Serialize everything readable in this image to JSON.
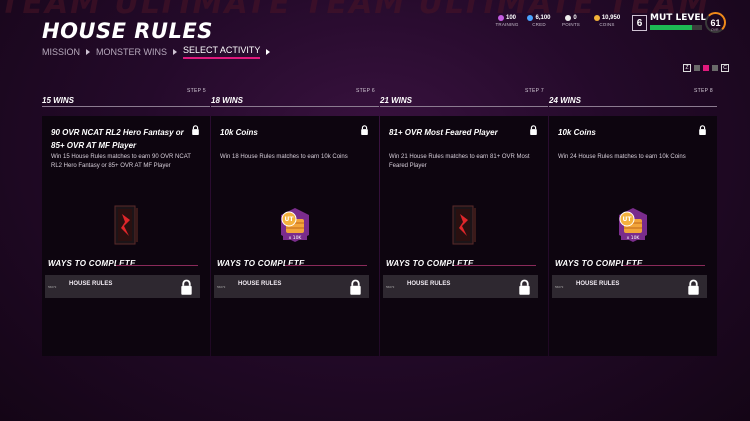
{
  "background_text": "TEAM ULTIMATE TEAM ULTIMATE TEAM",
  "header": {
    "title": "HOUSE RULES",
    "breadcrumb": [
      "MISSION",
      "MONSTER WINS",
      "SELECT ACTIVITY"
    ]
  },
  "currencies": [
    {
      "icon": "training-icon",
      "color": "#c45be0",
      "value": "100",
      "label": "TRAINING"
    },
    {
      "icon": "cred-icon",
      "color": "#4aa3ff",
      "value": "6,100",
      "label": "CRED"
    },
    {
      "icon": "points-icon",
      "color": "#eeeeee",
      "value": "0",
      "label": "POINTS"
    },
    {
      "icon": "coins-icon",
      "color": "#f2b339",
      "value": "10,950",
      "label": "COINS"
    }
  ],
  "mut": {
    "level": "6",
    "label": "MUT LEVEL",
    "progress": 0.8,
    "ovr": "61",
    "ovr_label": "OVR"
  },
  "pager": {
    "left_key": "Z",
    "right_key": "C",
    "pages": 3,
    "active": 1
  },
  "cards": [
    {
      "step": "STEP 5",
      "wins": "15 WINS",
      "title": "90 OVR NCAT RL2 Hero Fantasy or 85+ OVR AT MF Player",
      "desc": "Win 15 House Rules matches to earn 90 OVR NCAT RL2 Hero Fantasy or 85+ OVR AT MF Player",
      "reward": "pack",
      "ways": "WAYS TO COMPLETE",
      "task_id": "56073",
      "task": "HOUSE RULES"
    },
    {
      "step": "STEP 6",
      "wins": "18 WINS",
      "title": "10k Coins",
      "desc": "Win 18 House Rules matches to earn 10k Coins",
      "reward": "coins",
      "coin_label": "x 10K",
      "ways": "WAYS TO COMPLETE",
      "task_id": "56073",
      "task": "HOUSE RULES"
    },
    {
      "step": "STEP 7",
      "wins": "21 WINS",
      "title": "81+ OVR Most Feared Player",
      "desc": "Win 21 House Rules matches to earn 81+ OVR Most Feared Player",
      "reward": "pack",
      "ways": "WAYS TO COMPLETE",
      "task_id": "56073",
      "task": "HOUSE RULES"
    },
    {
      "step": "STEP 8",
      "wins": "24 WINS",
      "title": "10k Coins",
      "desc": "Win 24 House Rules matches to earn 10k Coins",
      "reward": "coins",
      "coin_label": "x 10K",
      "ways": "WAYS TO COMPLETE",
      "task_id": "56073",
      "task": "HOUSE RULES"
    }
  ]
}
